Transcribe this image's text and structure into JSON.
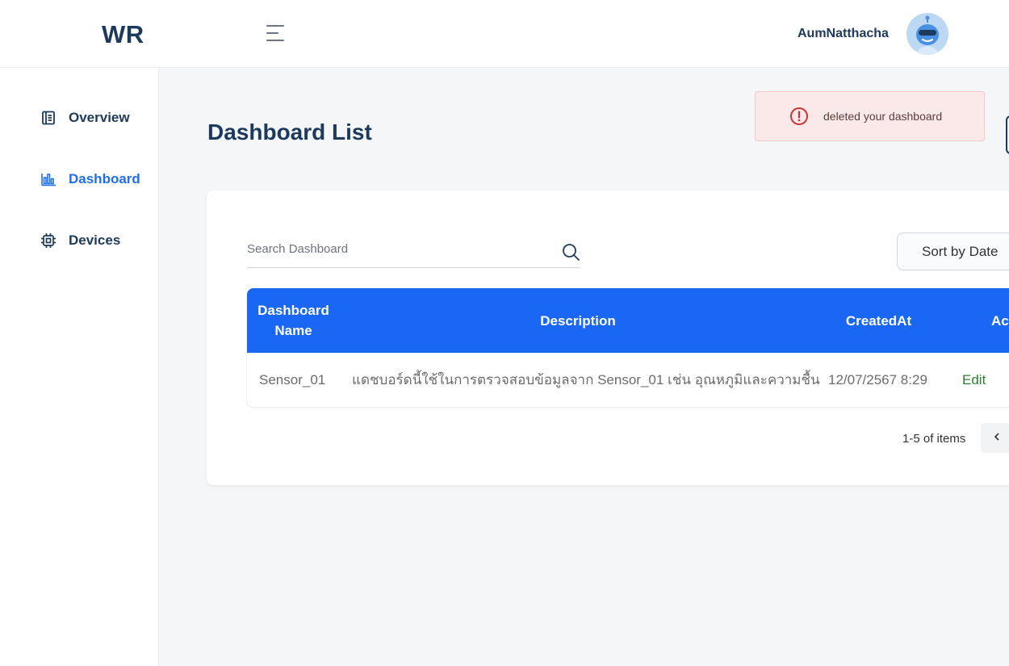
{
  "header": {
    "logo": "WR",
    "menu_icon": "hamburger-menu-icon",
    "username": "AumNatthacha",
    "avatar_icon": "robot-avatar-icon"
  },
  "sidebar": {
    "items": [
      {
        "label": "Overview",
        "icon": "overview-icon",
        "active": false
      },
      {
        "label": "Dashboard",
        "icon": "bar-chart-icon",
        "active": true
      },
      {
        "label": "Devices",
        "icon": "chip-icon",
        "active": false
      }
    ]
  },
  "page": {
    "title": "Dashboard List"
  },
  "toast": {
    "message": "deleted your dashboard",
    "icon": "error-circle-icon",
    "color": "#d32f2f"
  },
  "toolbar": {
    "search_placeholder": "Search Dashboard",
    "search_value": "",
    "sort_label": "Sort by Date"
  },
  "table": {
    "headers": [
      "Dashboard Name",
      "Description",
      "CreatedAt",
      "Action"
    ],
    "header_color": "#1a66f5",
    "rows": [
      {
        "name": "Sensor_01",
        "description": "แดชบอร์ดนี้ใช้ในการตรวจสอบข้อมูลจาก Sensor_01 เช่น อุณหภูมิและความชื้น",
        "created_at": "12/07/2567 8:29",
        "action": "Edit"
      }
    ]
  },
  "pagination": {
    "summary": "1-5 of items",
    "prev_icon": "chevron-left-icon"
  },
  "colors": {
    "accent": "#1f6fe8",
    "brand": "#1d3a5c",
    "edit": "#2e7d32"
  }
}
